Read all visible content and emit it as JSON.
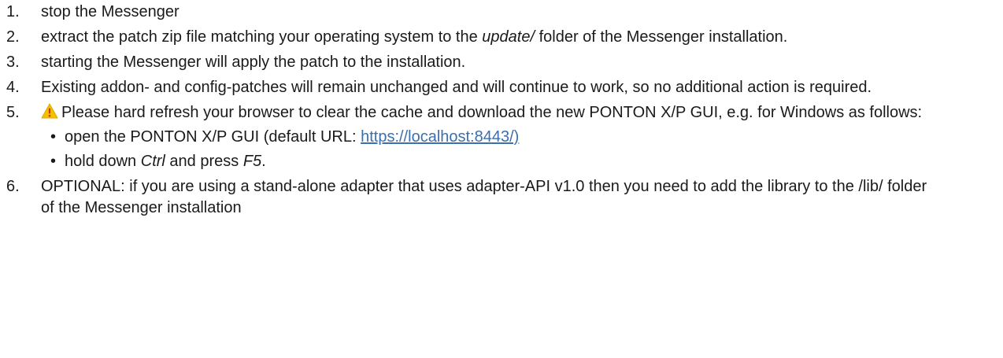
{
  "steps": [
    {
      "num": "1.",
      "text": "stop the Messenger"
    },
    {
      "num": "2.",
      "pre": "extract the patch zip file matching your operating system to the ",
      "em": "update/",
      "post": " folder of the Messenger installation."
    },
    {
      "num": "3.",
      "text": "starting the Messenger will apply the patch to the installation."
    },
    {
      "num": "4.",
      "text": "Existing addon- and config-patches will remain unchanged and will continue to work, so no additional action is required."
    },
    {
      "num": "5.",
      "icon": "warning-icon",
      "text": "Please hard refresh your browser to clear the cache and download the new PONTON X/P GUI, e.g. for Windows as follows:",
      "subs": [
        {
          "bullet": "•",
          "pre": "open the PONTON X/P GUI (default URL: ",
          "link": "https://localhost:8443/)"
        },
        {
          "bullet": "•",
          "pre": "hold down ",
          "em1": "Ctrl",
          "mid": " and press ",
          "em2": "F5",
          "post": "."
        }
      ]
    },
    {
      "num": "6.",
      "text": "OPTIONAL: if you are using a stand-alone adapter that uses adapter-API v1.0 then you need to add the library to the /lib/ folder of the Messenger installation"
    }
  ],
  "colors": {
    "link": "#3a6fb0",
    "warning_fill": "#f2c200",
    "warning_mark": "#c0392b"
  }
}
